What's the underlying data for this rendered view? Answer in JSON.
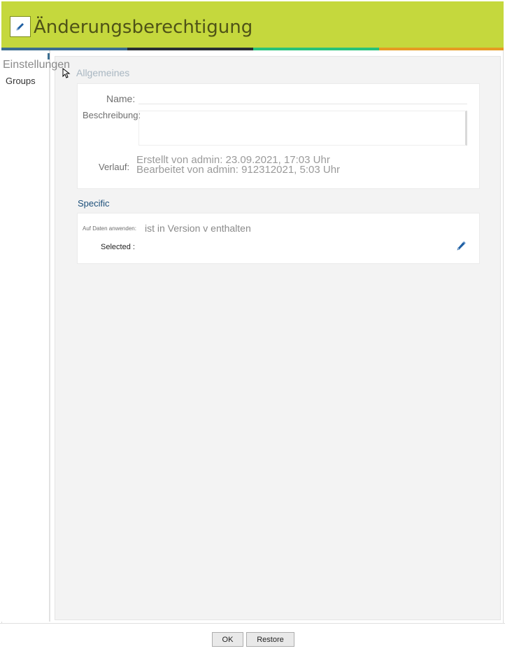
{
  "window": {
    "title": "Änderungsberechtigung",
    "title_icon": "pencil-icon"
  },
  "sidebar": {
    "items": [
      {
        "label": "Groups"
      }
    ]
  },
  "tab": {
    "label": "Einstellungen"
  },
  "general": {
    "section_title": "Allgemeines",
    "name_label": "Name:",
    "name_value": "",
    "description_label": "Beschreibung:",
    "description_value": "",
    "history_label": "Verlauf:",
    "history_lines": [
      "Erstellt von admin: 23.09.2021, 17:03 Uhr",
      "Bearbeitet von admin: 912312021, 5:03 Uhr"
    ]
  },
  "specific": {
    "section_title": "Specific",
    "apply_label": "Auf Daten anwenden:",
    "apply_value": "ist in Version v enthalten",
    "selected_label": "Selected :",
    "edit_icon": "pencil-icon"
  },
  "footer": {
    "ok_label": "OK",
    "restore_label": "Restore"
  },
  "colors": {
    "titlebar": "#c5d83d",
    "accent_blue": "#3c6e90",
    "accent_dark": "#2a2f33",
    "accent_green": "#27c27a",
    "accent_orange": "#e59b22"
  }
}
